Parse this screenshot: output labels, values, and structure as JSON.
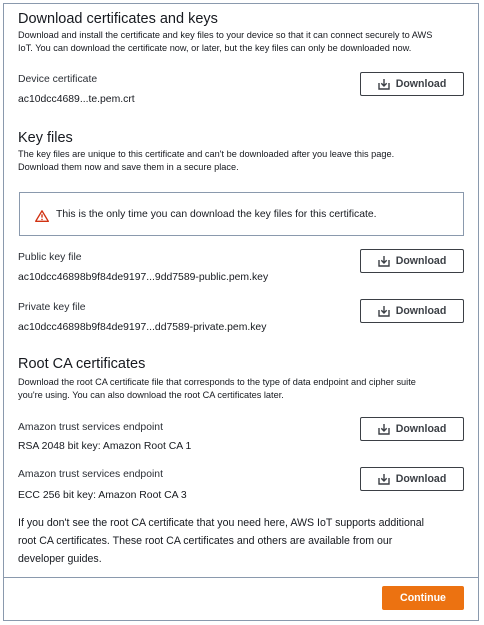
{
  "section_download": {
    "title": "Download certificates and keys",
    "description_line1": "Download and install the certificate and key files to your device so that it can connect securely to AWS",
    "description_line2": "IoT. You can download the certificate now, or later, but the key files can only be downloaded now."
  },
  "device_certificate": {
    "label": "Device certificate",
    "filename": "ac10dcc4689...te.pem.crt",
    "button_label": "Download"
  },
  "section_keys": {
    "title": "Key files",
    "description_line1": "The key files are unique to this certificate and can't be downloaded after you leave this page.",
    "description_line2": "Download them now and save them in a secure place."
  },
  "alert": {
    "icon": "warning-triangle-icon",
    "color": "#d13212",
    "text": "This is the only time you can download the key files for this certificate."
  },
  "public_key": {
    "label": "Public key file",
    "filename": "ac10dcc46898b9f84de9197...9dd7589-public.pem.key",
    "button_label": "Download"
  },
  "private_key": {
    "label": "Private key file",
    "filename": "ac10dcc46898b9f84de9197...dd7589-private.pem.key",
    "button_label": "Download"
  },
  "section_root_ca": {
    "title": "Root CA certificates",
    "description_line1": "Download the root CA certificate file that corresponds to the type of data endpoint and cipher suite",
    "description_line2": "you're using. You can also download the root CA certificates later."
  },
  "root_ca_1": {
    "label": "Amazon trust services endpoint",
    "value": "RSA 2048 bit key: Amazon Root CA 1",
    "button_label": "Download"
  },
  "root_ca_3": {
    "label": "Amazon trust services endpoint",
    "value": "ECC 256 bit key: Amazon Root CA 3",
    "button_label": "Download"
  },
  "note": {
    "line1": "If you don't see the root CA certificate that you need here, AWS IoT supports additional",
    "line2": "root CA certificates. These root CA certificates and others are available from our",
    "line3": "developer guides."
  },
  "footer": {
    "continue_label": "Continue",
    "accent_color": "#ec7211"
  }
}
